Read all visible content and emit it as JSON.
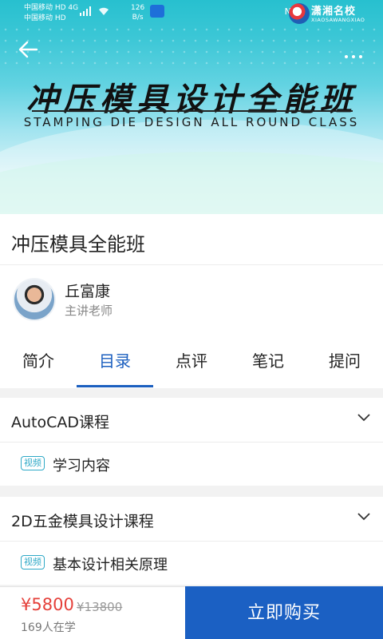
{
  "status_bar": {
    "carrier_line1": "中国移动 HD 4G",
    "carrier_line2": "中国移动 HD",
    "signal": "4G",
    "speed_value": "126",
    "speed_unit": "B/s",
    "right_icons": "N ⏰"
  },
  "logo": {
    "text": "潇湘名校",
    "subtext": "XIAOSAWANGXIAO"
  },
  "banner": {
    "title": "冲压模具设计全能班",
    "subtitle": "STAMPING DIE DESIGN ALL ROUND CLASS"
  },
  "course": {
    "title": "冲压模具全能班"
  },
  "teacher": {
    "name": "丘富康",
    "role": "主讲老师"
  },
  "tabs": [
    {
      "label": "简介"
    },
    {
      "label": "目录"
    },
    {
      "label": "点评"
    },
    {
      "label": "笔记"
    },
    {
      "label": "提问"
    }
  ],
  "active_tab": "目录",
  "sections": [
    {
      "title": "AutoCAD课程",
      "lessons": [
        {
          "tag": "视频",
          "title": "学习内容"
        }
      ]
    },
    {
      "title": "2D五金模具设计课程",
      "lessons": [
        {
          "tag": "视频",
          "title": "基本设计相关原理"
        }
      ]
    }
  ],
  "purchase": {
    "price": "¥5800",
    "original_price": "¥13800",
    "learners": "169人在学",
    "buy_label": "立即购买"
  },
  "colors": {
    "accent": "#1b5fbf",
    "price": "#e5403a",
    "tag": "#2fa9c7",
    "button": "#1b60c3"
  }
}
